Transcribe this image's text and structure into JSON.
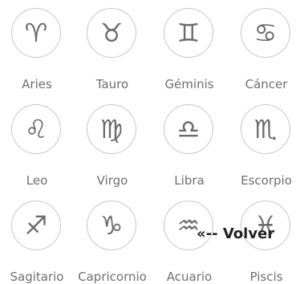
{
  "signs": [
    {
      "name": "Aries",
      "glyph": "♈︎",
      "icon": "aries-icon"
    },
    {
      "name": "Tauro",
      "glyph": "♉︎",
      "icon": "taurus-icon"
    },
    {
      "name": "Géminis",
      "glyph": "♊︎",
      "icon": "gemini-icon"
    },
    {
      "name": "Cáncer",
      "glyph": "♋︎",
      "icon": "cancer-icon"
    },
    {
      "name": "Leo",
      "glyph": "♌︎",
      "icon": "leo-icon"
    },
    {
      "name": "Virgo",
      "glyph": "♍︎",
      "icon": "virgo-icon"
    },
    {
      "name": "Libra",
      "glyph": "♎︎",
      "icon": "libra-icon"
    },
    {
      "name": "Escorpio",
      "glyph": "♏︎",
      "icon": "scorpio-icon"
    },
    {
      "name": "Sagitario",
      "glyph": "♐︎",
      "icon": "sagittarius-icon"
    },
    {
      "name": "Capricornio",
      "glyph": "♑︎",
      "icon": "capricorn-icon"
    },
    {
      "name": "Acuario",
      "glyph": "♒︎",
      "icon": "aquarius-icon"
    },
    {
      "name": "Piscis",
      "glyph": "♓︎",
      "icon": "pisces-icon"
    }
  ],
  "back_label": "«-- Volver",
  "colors": {
    "icon": "#6b6b6b",
    "border": "#c6c6c6",
    "label": "#6f6f6f",
    "back_text": "#222222"
  }
}
